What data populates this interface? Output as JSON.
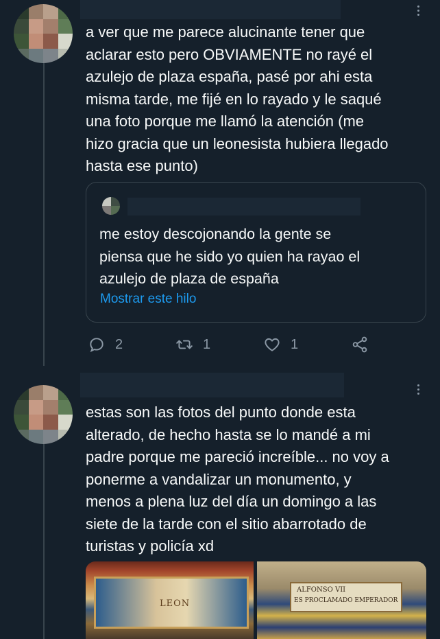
{
  "tweet1": {
    "text": "a ver que me parece alucinante tener que\naclarar esto pero OBVIAMENTE no rayé el\nazulejo de plaza españa, pasé por ahi esta\nmisma tarde, me fijé en lo rayado y le saqué\nuna foto porque me llamó la atención (me\nhizo gracia que un leonesista hubiera llegado\nhasta ese punto)",
    "quote": {
      "text": "me estoy descojonando la gente se\npiensa que he sido yo quien ha rayao el\nazulejo de plaza de españa",
      "show_thread": "Mostrar este hilo"
    },
    "actions": {
      "reply_count": "2",
      "retweet_count": "1",
      "like_count": "1"
    }
  },
  "tweet2": {
    "text": "estas son las fotos del punto donde esta\nalterado, de hecho hasta se lo mandé a mi\npadre porque me pareció increíble... no voy a\nponerme a vandalizar un monumento, y\nmenos a plena luz del día un domingo a las\nsiete de la tarde con el sitio abarrotado de\nturistas y policía xd",
    "photo1_label": "LEON",
    "photo2_label_line1": "ALFONSO VII",
    "photo2_label_line2": "ES PROCLAMADO EMPERADOR"
  },
  "colors": {
    "background": "#15202b",
    "text": "#f7f9f9",
    "secondary": "#8b98a5",
    "link": "#1d9bf0",
    "border": "#38444d"
  },
  "icons": {
    "more": "more-dots-icon",
    "reply": "reply-icon",
    "retweet": "retweet-icon",
    "like": "like-icon",
    "share": "share-icon"
  }
}
